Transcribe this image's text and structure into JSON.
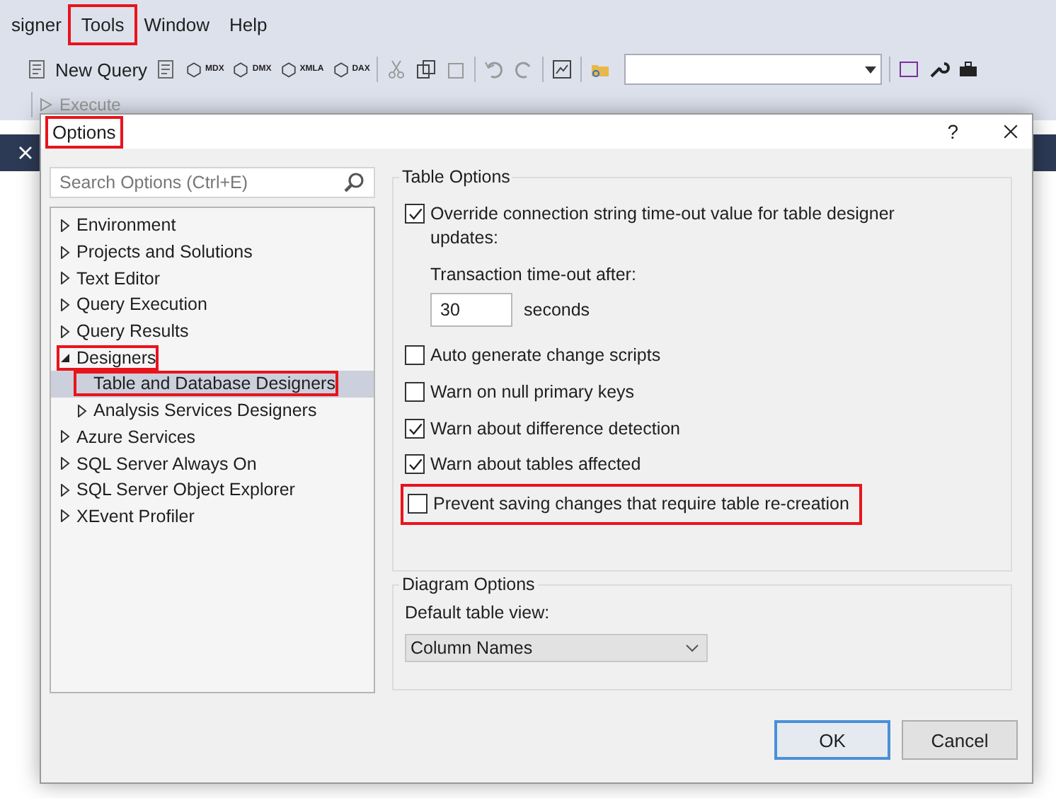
{
  "menu": [
    {
      "label": "signer",
      "highlighted": false
    },
    {
      "label": "Tools",
      "highlighted": true
    },
    {
      "label": "Window",
      "highlighted": false
    },
    {
      "label": "Help",
      "highlighted": false
    }
  ],
  "toolbar": {
    "new_query": "New Query",
    "query_icons": [
      "MDX",
      "DMX",
      "XMLA",
      "DAX"
    ]
  },
  "toolbar2": {
    "execute": "Execute"
  },
  "dialog": {
    "title": "Options",
    "title_highlighted": true,
    "help": "?",
    "search": {
      "placeholder": "Search Options (Ctrl+E)"
    },
    "tree": [
      {
        "label": "Environment",
        "expanded": false,
        "selected": false,
        "highlighted": false
      },
      {
        "label": "Projects and Solutions",
        "expanded": false,
        "selected": false,
        "highlighted": false
      },
      {
        "label": "Text Editor",
        "expanded": false,
        "selected": false,
        "highlighted": false
      },
      {
        "label": "Query Execution",
        "expanded": false,
        "selected": false,
        "highlighted": false
      },
      {
        "label": "Query Results",
        "expanded": false,
        "selected": false,
        "highlighted": false
      },
      {
        "label": "Designers",
        "expanded": true,
        "selected": false,
        "highlighted": true,
        "children": [
          {
            "label": "Table and Database Designers",
            "selected": true,
            "highlighted": true
          },
          {
            "label": "Analysis Services Designers",
            "expanded": false,
            "selected": false,
            "highlighted": false
          }
        ]
      },
      {
        "label": "Azure Services",
        "expanded": false,
        "selected": false,
        "highlighted": false
      },
      {
        "label": "SQL Server Always On",
        "expanded": false,
        "selected": false,
        "highlighted": false
      },
      {
        "label": "SQL Server Object Explorer",
        "expanded": false,
        "selected": false,
        "highlighted": false
      },
      {
        "label": "XEvent Profiler",
        "expanded": false,
        "selected": false,
        "highlighted": false
      }
    ],
    "table_options": {
      "title": "Table Options",
      "items": [
        {
          "kind": "check",
          "label": "Override connection string time-out value for table designer updates:",
          "checked": true,
          "highlighted": false
        },
        {
          "kind": "timeout",
          "label": "Transaction time-out after:",
          "value": "30",
          "unit": "seconds"
        },
        {
          "kind": "check",
          "label": "Auto generate change scripts",
          "checked": false,
          "highlighted": false
        },
        {
          "kind": "check",
          "label": "Warn on null primary keys",
          "checked": false,
          "highlighted": false
        },
        {
          "kind": "check",
          "label": "Warn about difference detection",
          "checked": true,
          "highlighted": false
        },
        {
          "kind": "check",
          "label": "Warn about tables affected",
          "checked": true,
          "highlighted": false
        },
        {
          "kind": "check",
          "label": "Prevent saving changes that require table re-creation",
          "checked": false,
          "highlighted": true
        }
      ]
    },
    "diagram_options": {
      "title": "Diagram Options",
      "label": "Default table view:",
      "value": "Column Names"
    },
    "buttons": [
      {
        "label": "OK",
        "default": true
      },
      {
        "label": "Cancel",
        "default": false
      }
    ]
  }
}
